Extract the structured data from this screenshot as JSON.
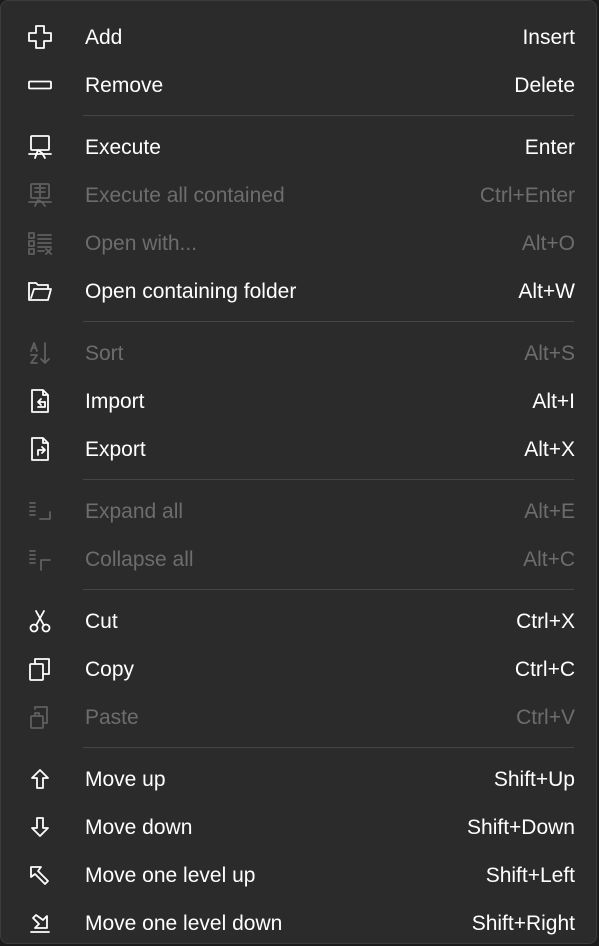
{
  "menu": {
    "items": [
      {
        "label": "Add",
        "shortcut": "Insert",
        "icon": "plus-icon",
        "enabled": true
      },
      {
        "label": "Remove",
        "shortcut": "Delete",
        "icon": "minus-icon",
        "enabled": true
      },
      {
        "label": "Execute",
        "shortcut": "Enter",
        "icon": "execute-icon",
        "enabled": true
      },
      {
        "label": "Execute all contained",
        "shortcut": "Ctrl+Enter",
        "icon": "execute-all-icon",
        "enabled": false
      },
      {
        "label": "Open with...",
        "shortcut": "Alt+O",
        "icon": "open-with-icon",
        "enabled": false
      },
      {
        "label": "Open containing folder",
        "shortcut": "Alt+W",
        "icon": "folder-open-icon",
        "enabled": true
      },
      {
        "label": "Sort",
        "shortcut": "Alt+S",
        "icon": "sort-icon",
        "enabled": false
      },
      {
        "label": "Import",
        "shortcut": "Alt+I",
        "icon": "import-icon",
        "enabled": true
      },
      {
        "label": "Export",
        "shortcut": "Alt+X",
        "icon": "export-icon",
        "enabled": true
      },
      {
        "label": "Expand all",
        "shortcut": "Alt+E",
        "icon": "expand-all-icon",
        "enabled": false
      },
      {
        "label": "Collapse all",
        "shortcut": "Alt+C",
        "icon": "collapse-all-icon",
        "enabled": false
      },
      {
        "label": "Cut",
        "shortcut": "Ctrl+X",
        "icon": "scissors-icon",
        "enabled": true
      },
      {
        "label": "Copy",
        "shortcut": "Ctrl+C",
        "icon": "copy-icon",
        "enabled": true
      },
      {
        "label": "Paste",
        "shortcut": "Ctrl+V",
        "icon": "paste-icon",
        "enabled": false
      },
      {
        "label": "Move up",
        "shortcut": "Shift+Up",
        "icon": "arrow-up-icon",
        "enabled": true
      },
      {
        "label": "Move down",
        "shortcut": "Shift+Down",
        "icon": "arrow-down-icon",
        "enabled": true
      },
      {
        "label": "Move one level up",
        "shortcut": "Shift+Left",
        "icon": "arrow-level-up-icon",
        "enabled": true
      },
      {
        "label": "Move one level down",
        "shortcut": "Shift+Right",
        "icon": "arrow-level-down-icon",
        "enabled": true
      }
    ]
  },
  "colors": {
    "background": "#2b2b2b",
    "text": "#ffffff",
    "disabled_text": "#6d6d6d",
    "separator": "#454545"
  }
}
